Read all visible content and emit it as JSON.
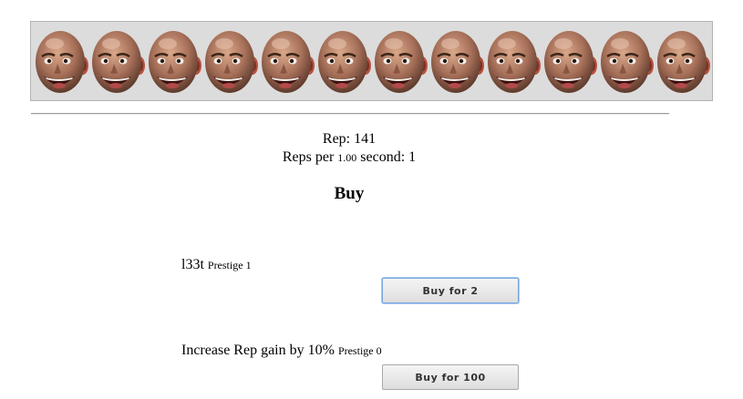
{
  "banner": {
    "face_count": 12,
    "face_icon": "bald-laughing-head-icon"
  },
  "stats": {
    "rep_label": "Rep:",
    "rep_value": "141",
    "rps_prefix": "Reps per",
    "rps_interval": "1.00",
    "rps_suffix": "second:",
    "rps_value": "1"
  },
  "shop": {
    "heading": "Buy",
    "items": [
      {
        "name": "l33t",
        "prestige_label": "Prestige",
        "prestige_value": "1",
        "button_label": "Buy for 2"
      },
      {
        "name": "Increase Rep gain by 10%",
        "prestige_label": "Prestige",
        "prestige_value": "0",
        "button_label": "Buy for 100"
      }
    ]
  }
}
